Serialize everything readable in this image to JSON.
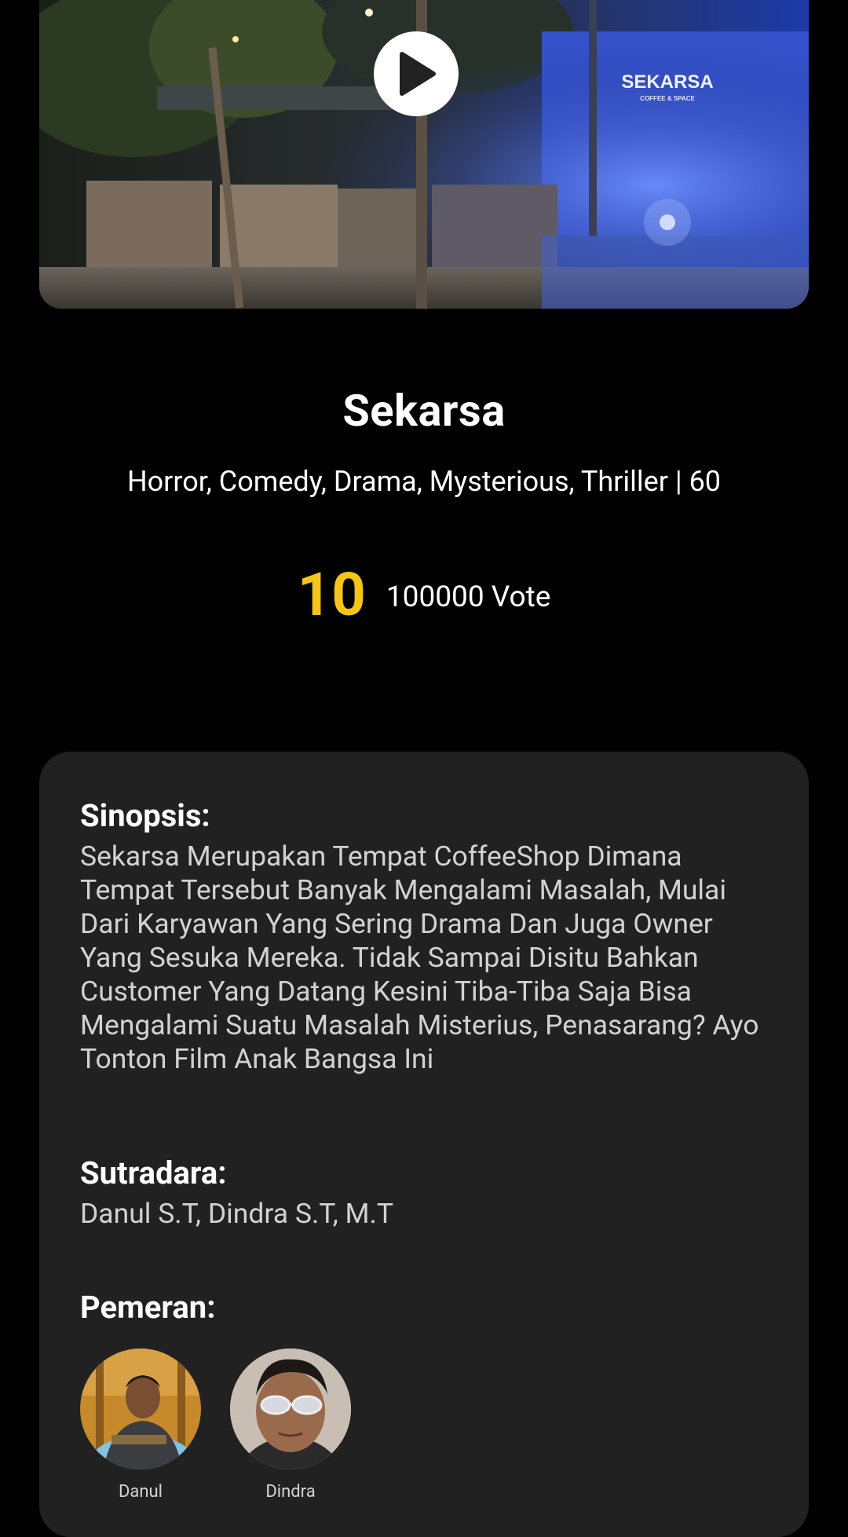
{
  "movie": {
    "title": "Sekarsa",
    "genres_duration": "Horror, Comedy, Drama, Mysterious, Thriller | 60",
    "rating": "10",
    "votes": "100000 Vote"
  },
  "hero": {
    "sign_text": "SEKARSA",
    "sign_subtext": "COFFEE & SPACE",
    "play_icon": "play-icon"
  },
  "synopsis": {
    "label": "Sinopsis:",
    "text": "Sekarsa Merupakan Tempat CoffeeShop Dimana Tempat Tersebut Banyak Mengalami Masalah, Mulai Dari Karyawan Yang Sering Drama Dan Juga Owner Yang Sesuka Mereka. Tidak Sampai Disitu Bahkan Customer Yang Datang Kesini Tiba-Tiba Saja Bisa Mengalami Suatu Masalah Misterius, Penasarang? Ayo Tonton Film Anak Bangsa Ini"
  },
  "director": {
    "label": "Sutradara:",
    "names": "Danul S.T, Dindra S.T, M.T"
  },
  "cast": {
    "label": "Pemeran:",
    "members": [
      {
        "name": "Danul"
      },
      {
        "name": "Dindra"
      }
    ]
  },
  "colors": {
    "background": "#000000",
    "card": "#212121",
    "rating": "#f5c518"
  }
}
